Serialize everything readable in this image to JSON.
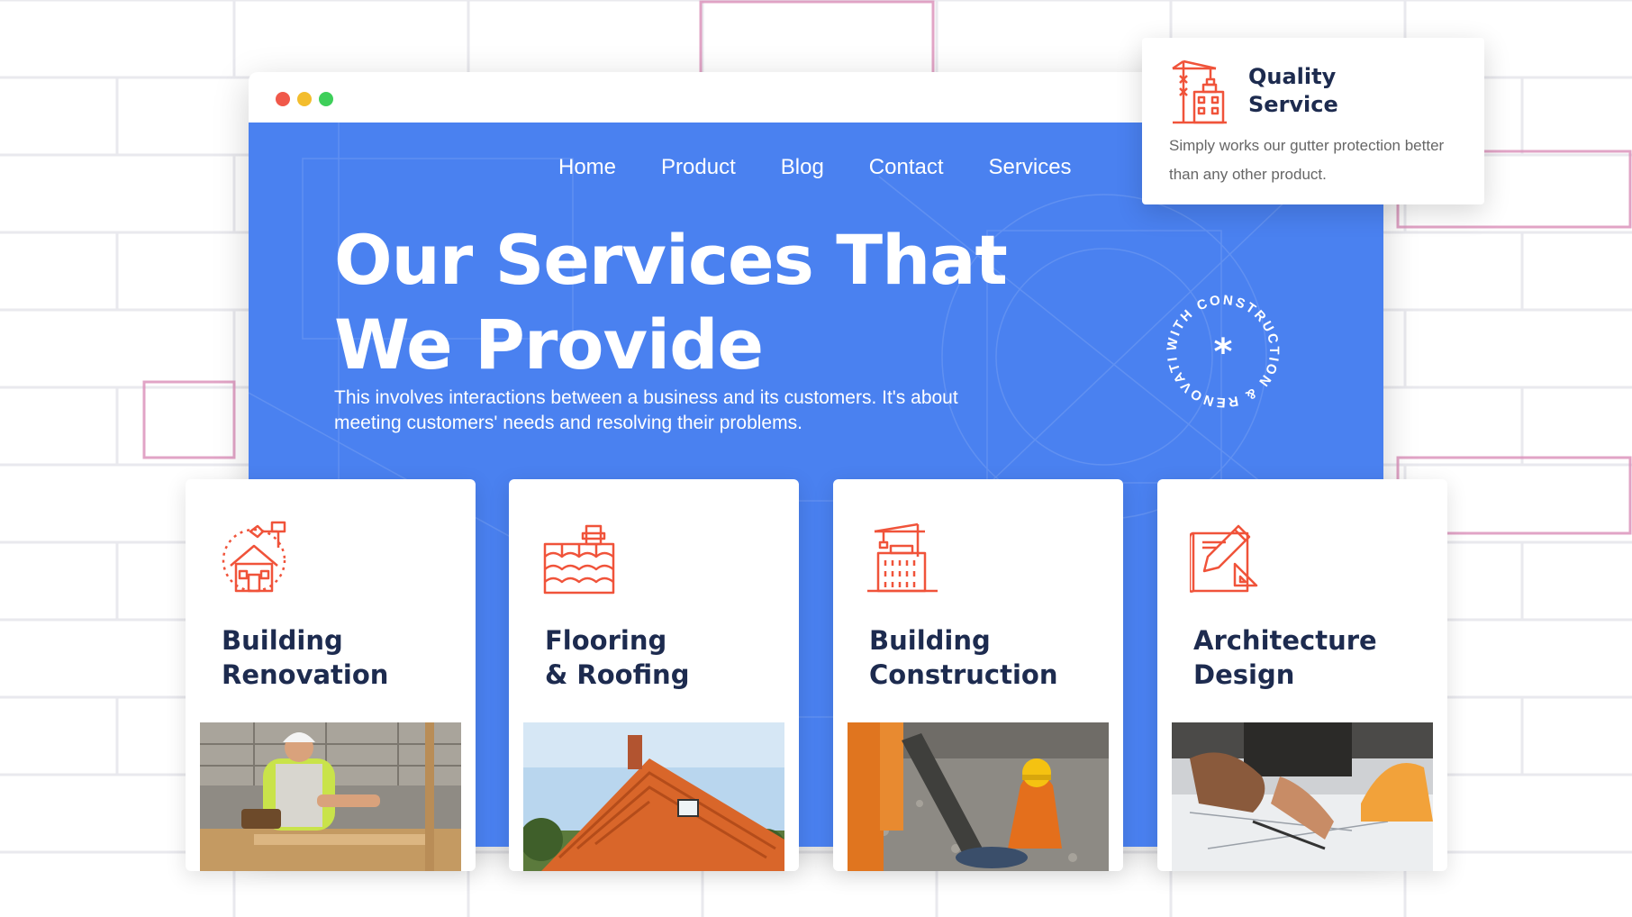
{
  "nav": {
    "items": [
      "Home",
      "Product",
      "Blog",
      "Contact",
      "Services"
    ]
  },
  "hero": {
    "title_line1": "Our Services That",
    "title_line2": "We Provide",
    "subtitle": "This involves interactions between a business and its customers. It's about meeting customers' needs and resolving their problems.",
    "badge_text": "WITH CONSTRUCTION & RENOVATION"
  },
  "quality_card": {
    "title_line1": "Quality",
    "title_line2": "Service",
    "description": "Simply works our gutter protection better than any other product.",
    "icon": "crane-building-icon"
  },
  "services": [
    {
      "title_line1": "Building",
      "title_line2": "Renovation",
      "icon": "house-tools-icon",
      "photo": "worker-measuring-wood"
    },
    {
      "title_line1": "Flooring",
      "title_line2": "& Roofing",
      "icon": "roof-tiles-icon",
      "photo": "orange-tiled-roof"
    },
    {
      "title_line1": "Building",
      "title_line2": "Construction",
      "icon": "crane-building-icon",
      "photo": "workers-on-site"
    },
    {
      "title_line1": "Architecture",
      "title_line2": "Design",
      "icon": "blueprint-pencil-icon",
      "photo": "architects-drawing"
    }
  ],
  "colors": {
    "hero_blue": "#4a81f0",
    "accent_orange": "#f0533a",
    "heading_navy": "#1d2b4f",
    "window_red": "#f0584a",
    "window_yellow": "#f3bd2d",
    "window_green": "#3ecf5a"
  }
}
